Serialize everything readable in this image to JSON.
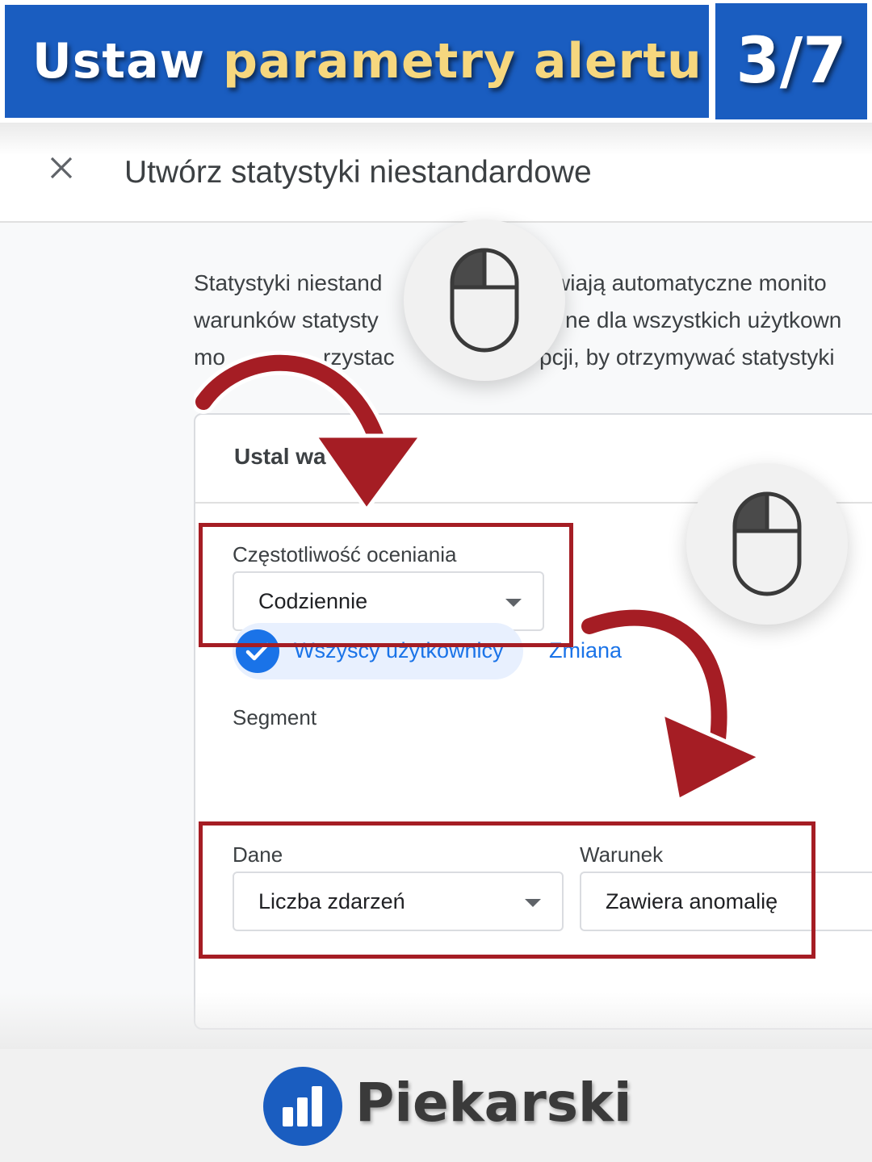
{
  "banner": {
    "title_plain": "Ustaw",
    "title_highlight": "parametry alertu",
    "step": "3/7"
  },
  "dialog": {
    "title": "Utwórz statystyki niestandardowe",
    "description_lines": [
      "Statystyki niestand",
      "wiają automatyczne monito",
      "warunków statysty",
      "ne dla wszystkich użytkown",
      "mo",
      "rzystac",
      "pcji, by otrzymywać statystyki"
    ],
    "card_title": "Ustal wa",
    "frequency": {
      "label": "Częstotliwość oceniania",
      "value": "Codziennie"
    },
    "segment": {
      "label": "Segment",
      "chip": "Wszyscy użytkownicy",
      "change_link": "Zmiana"
    },
    "metric": {
      "label": "Dane",
      "value": "Liczba zdarzeń"
    },
    "condition": {
      "label": "Warunek",
      "value": "Zawiera anomalię"
    }
  },
  "footer": {
    "brand": "Piekarski"
  },
  "colors": {
    "banner": "#1a5dc0",
    "highlight": "#f6d77e",
    "arrow": "#a51d24",
    "accent": "#1a73e8"
  },
  "icons": [
    "close-icon",
    "mouse-click-icon",
    "checkmark-icon",
    "chevron-down-icon",
    "bar-chart-icon",
    "curved-arrow-icon"
  ]
}
